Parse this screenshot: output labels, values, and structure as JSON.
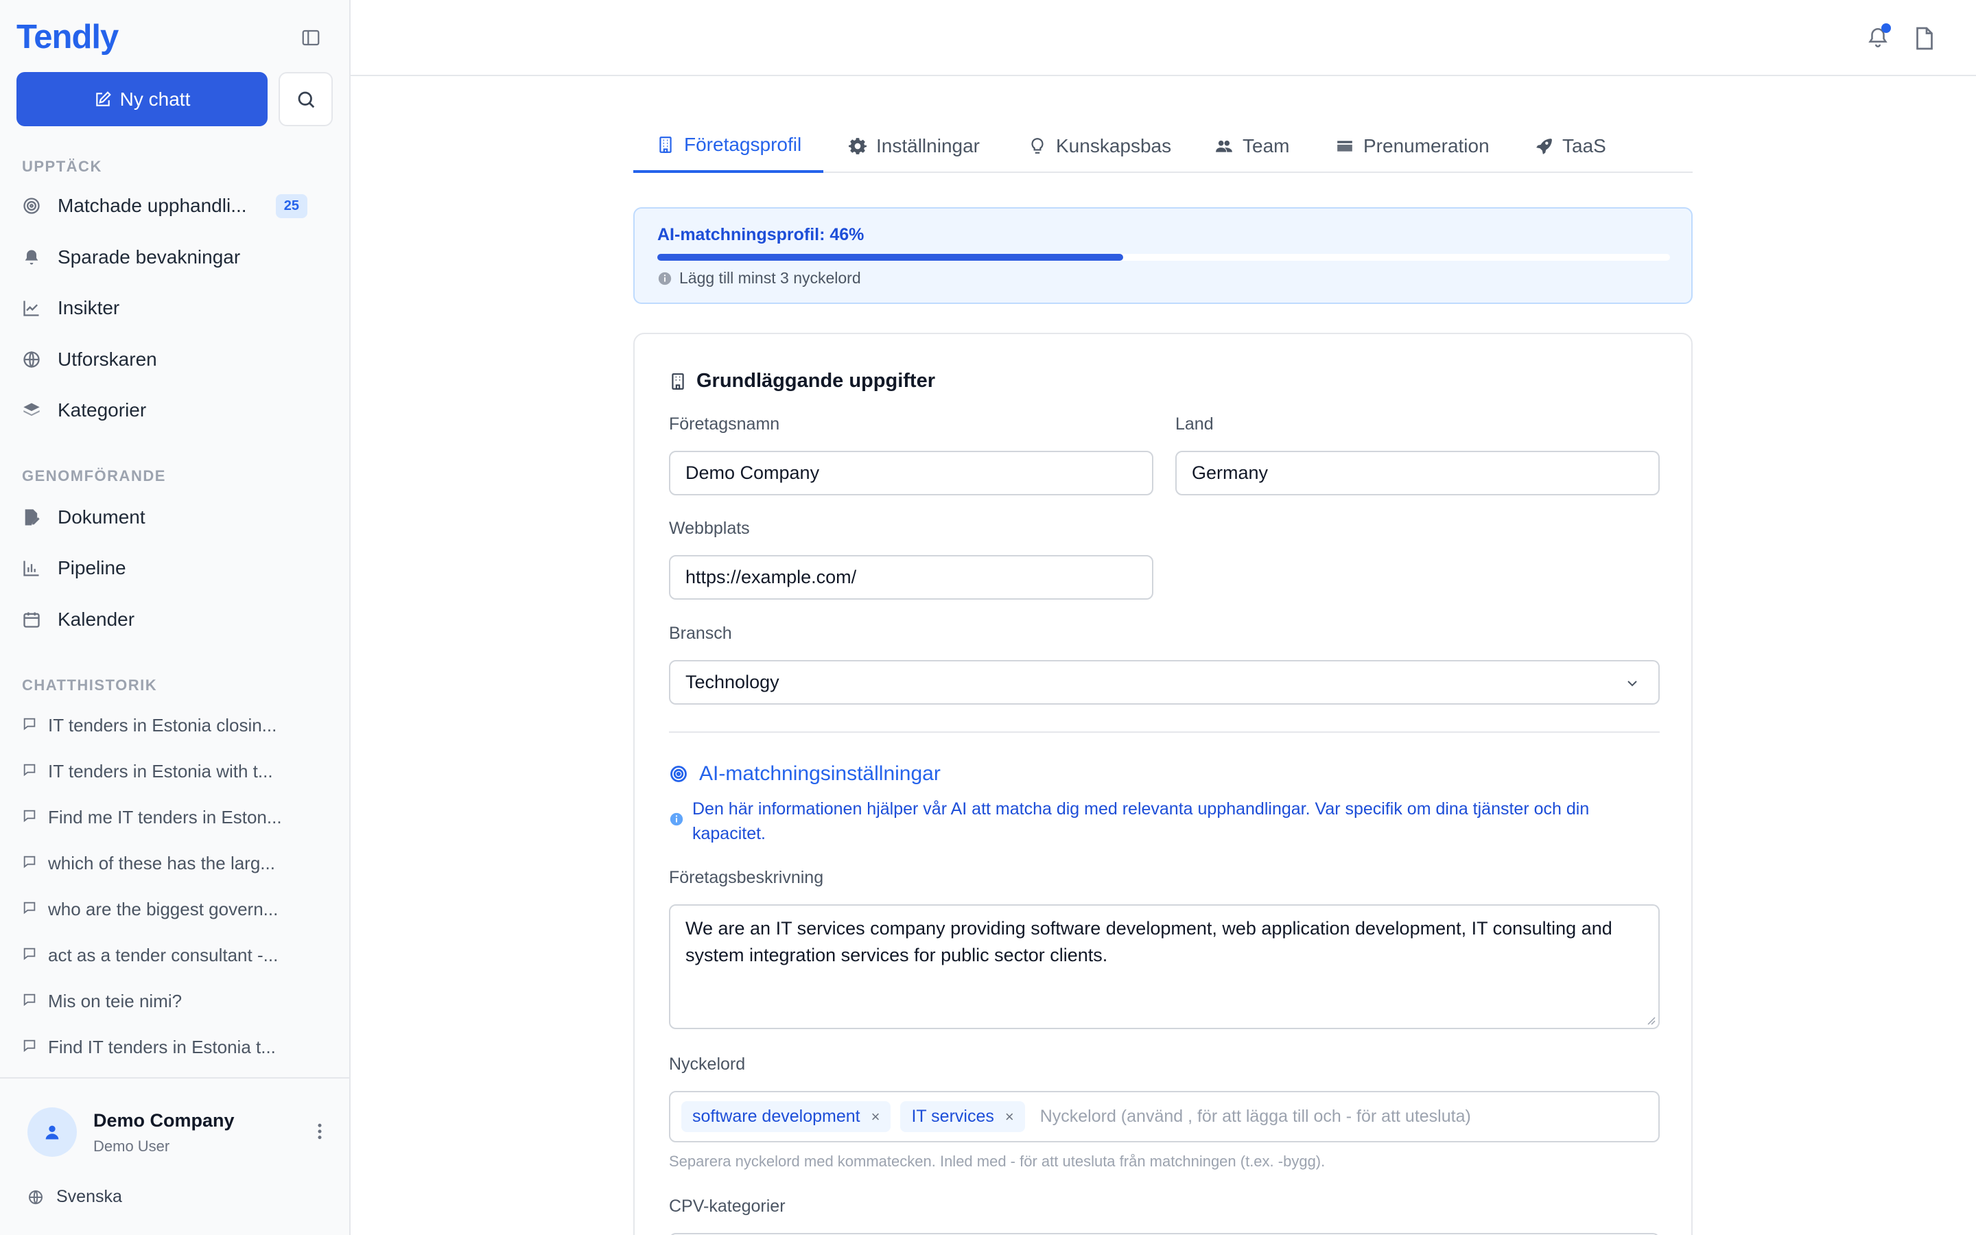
{
  "app": {
    "name": "Tendly"
  },
  "sidebar": {
    "new_chat_label": "Ny chatt",
    "sections": {
      "discover": "UPPTÄCK",
      "execution": "GENOMFÖRANDE",
      "history": "CHATTHISTORIK"
    },
    "discover_items": [
      {
        "label": "Matchade upphandli...",
        "icon": "target-icon",
        "badge": "25"
      },
      {
        "label": "Sparade bevakningar",
        "icon": "bell-icon"
      },
      {
        "label": "Insikter",
        "icon": "chart-line-icon"
      },
      {
        "label": "Utforskaren",
        "icon": "globe-icon"
      },
      {
        "label": "Kategorier",
        "icon": "layers-icon"
      }
    ],
    "execution_items": [
      {
        "label": "Dokument",
        "icon": "file-edit-icon"
      },
      {
        "label": "Pipeline",
        "icon": "bar-chart-icon"
      },
      {
        "label": "Kalender",
        "icon": "calendar-icon"
      }
    ],
    "chat_history": [
      "IT tenders in Estonia closin...",
      "IT tenders in Estonia with t...",
      "Find me IT tenders in Eston...",
      "which of these has the larg...",
      "who are the biggest govern...",
      "act as a tender consultant -...",
      "Mis on teie nimi?",
      "Find IT tenders in Estonia t..."
    ],
    "user": {
      "name": "Demo Company",
      "role": "Demo User"
    },
    "language": "Svenska"
  },
  "tabs": [
    {
      "label": "Företagsprofil",
      "icon": "building-icon",
      "active": true
    },
    {
      "label": "Inställningar",
      "icon": "gear-icon"
    },
    {
      "label": "Kunskapsbas",
      "icon": "lightbulb-icon"
    },
    {
      "label": "Team",
      "icon": "users-icon"
    },
    {
      "label": "Prenumeration",
      "icon": "credit-card-icon"
    },
    {
      "label": "TaaS",
      "icon": "rocket-icon"
    }
  ],
  "profile_progress": {
    "title": "AI-matchningsprofil: 46%",
    "percent": 46,
    "hint": "Lägg till minst 3 nyckelord"
  },
  "basic": {
    "title": "Grundläggande uppgifter",
    "company_name_label": "Företagsnamn",
    "company_name_value": "Demo Company",
    "country_label": "Land",
    "country_value": "Germany",
    "website_label": "Webbplats",
    "website_value": "https://example.com/",
    "industry_label": "Bransch",
    "industry_value": "Technology"
  },
  "ai": {
    "title": "AI-matchningsinställningar",
    "info": "Den här informationen hjälper vår AI att matcha dig med relevanta upphandlingar. Var specifik om dina tjänster och din kapacitet.",
    "description_label": "Företagsbeskrivning",
    "description_value": "We are an IT services company providing software development, web application development, IT consulting and system integration services for public sector clients.",
    "keywords_label": "Nyckelord",
    "keywords": [
      "software development",
      "IT services"
    ],
    "keywords_placeholder": "Nyckelord (använd , för att lägga till och - för att utesluta)",
    "keywords_help": "Separera nyckelord med kommatecken. Inled med - för att utesluta från matchningen (t.ex. -bygg).",
    "cpv_label": "CPV-kategorier"
  },
  "colors": {
    "accent": "#2563eb",
    "notification_dot": "#2563eb"
  }
}
